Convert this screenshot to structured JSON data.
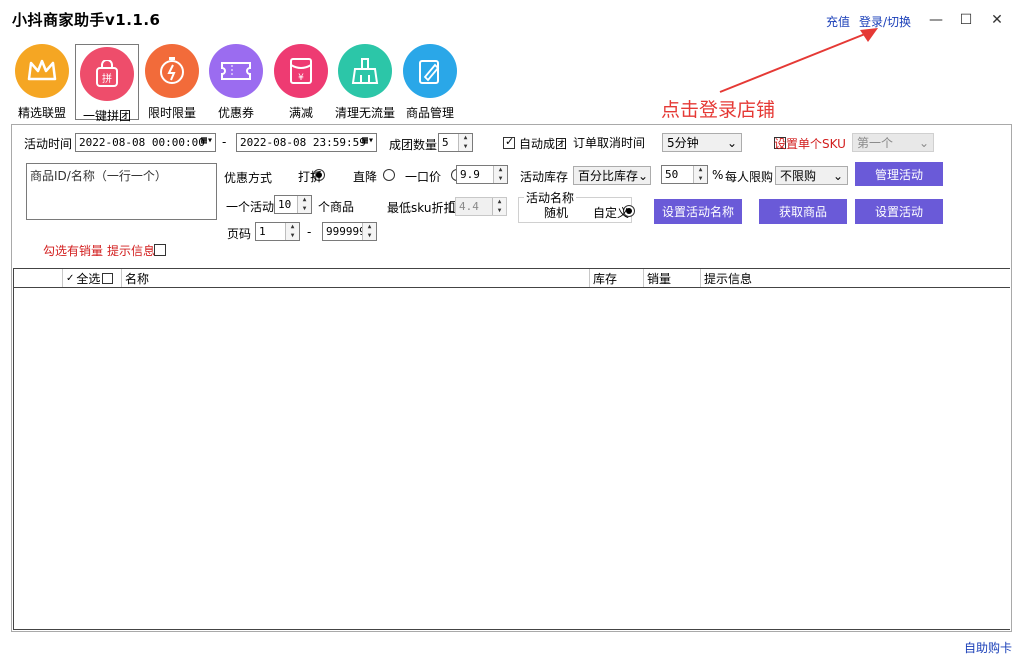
{
  "app": {
    "title": "小抖商家助手v1.1.6",
    "recharge_link": "充值",
    "login_link": "登录/切换"
  },
  "window_controls": {
    "minimize": "—",
    "maximize": "☐",
    "close": "✕"
  },
  "annotation": {
    "text": "点击登录店铺",
    "color": "#e53935"
  },
  "nav": [
    {
      "label": "精选联盟",
      "icon": "crown-icon",
      "color": "#f5a623"
    },
    {
      "label": "一键拼团",
      "icon": "group-buy-icon",
      "color": "#ee4d6b",
      "glyph": "拼"
    },
    {
      "label": "限时限量",
      "icon": "timer-icon",
      "color": "#f26b3a"
    },
    {
      "label": "优惠券",
      "icon": "coupon-icon",
      "color": "#9b6cf0"
    },
    {
      "label": "满减",
      "icon": "discount-envelope-icon",
      "color": "#ee3b72",
      "glyph": "¥"
    },
    {
      "label": "清理无流量",
      "icon": "broom-icon",
      "color": "#2cc6a8"
    },
    {
      "label": "商品管理",
      "icon": "edit-icon",
      "color": "#2aa7e8"
    }
  ],
  "form": {
    "activity_time_label": "活动时间",
    "start_time": "2022-08-08 00:00:00",
    "dash": "-",
    "end_time": "2022-08-08 23:59:59",
    "group_count_label": "成团数量",
    "group_count_value": "5",
    "auto_group_label": "自动成团",
    "order_cancel_label": "订单取消时间",
    "order_cancel_value": "5分钟",
    "single_sku_label": "设置单个SKU",
    "single_sku_value": "第一个",
    "product_id_placeholder": "商品ID/名称（一行一个）",
    "discount_mode_label": "优惠方式",
    "mode_discount": "打折",
    "mode_reduce": "直降",
    "mode_fixed": "一口价",
    "discount_value": "9.9",
    "stock_label": "活动库存",
    "stock_mode": "百分比库存",
    "stock_percent": "50",
    "percent_sign": "%",
    "per_limit_label": "每人限购",
    "per_limit_value": "不限购",
    "manage_btn": "管理活动",
    "per_activity_label": "一个活动",
    "per_activity_value": "10",
    "products_unit": "个商品",
    "min_sku_label": "最低sku折扣",
    "min_sku_value": "4.4",
    "activity_name_group": "活动名称",
    "name_random": "随机",
    "name_custom": "自定义",
    "set_name_btn": "设置活动名称",
    "get_products_btn": "获取商品",
    "set_activity_btn": "设置活动",
    "page_label": "页码",
    "page_from": "1",
    "page_to": "999999",
    "sold_checkbox_label": "勾选有销量",
    "hint_label": "提示信息"
  },
  "table": {
    "columns": [
      "",
      "全选",
      "名称",
      "库存",
      "销量",
      "提示信息"
    ]
  },
  "footer": {
    "link": "自助购卡"
  }
}
